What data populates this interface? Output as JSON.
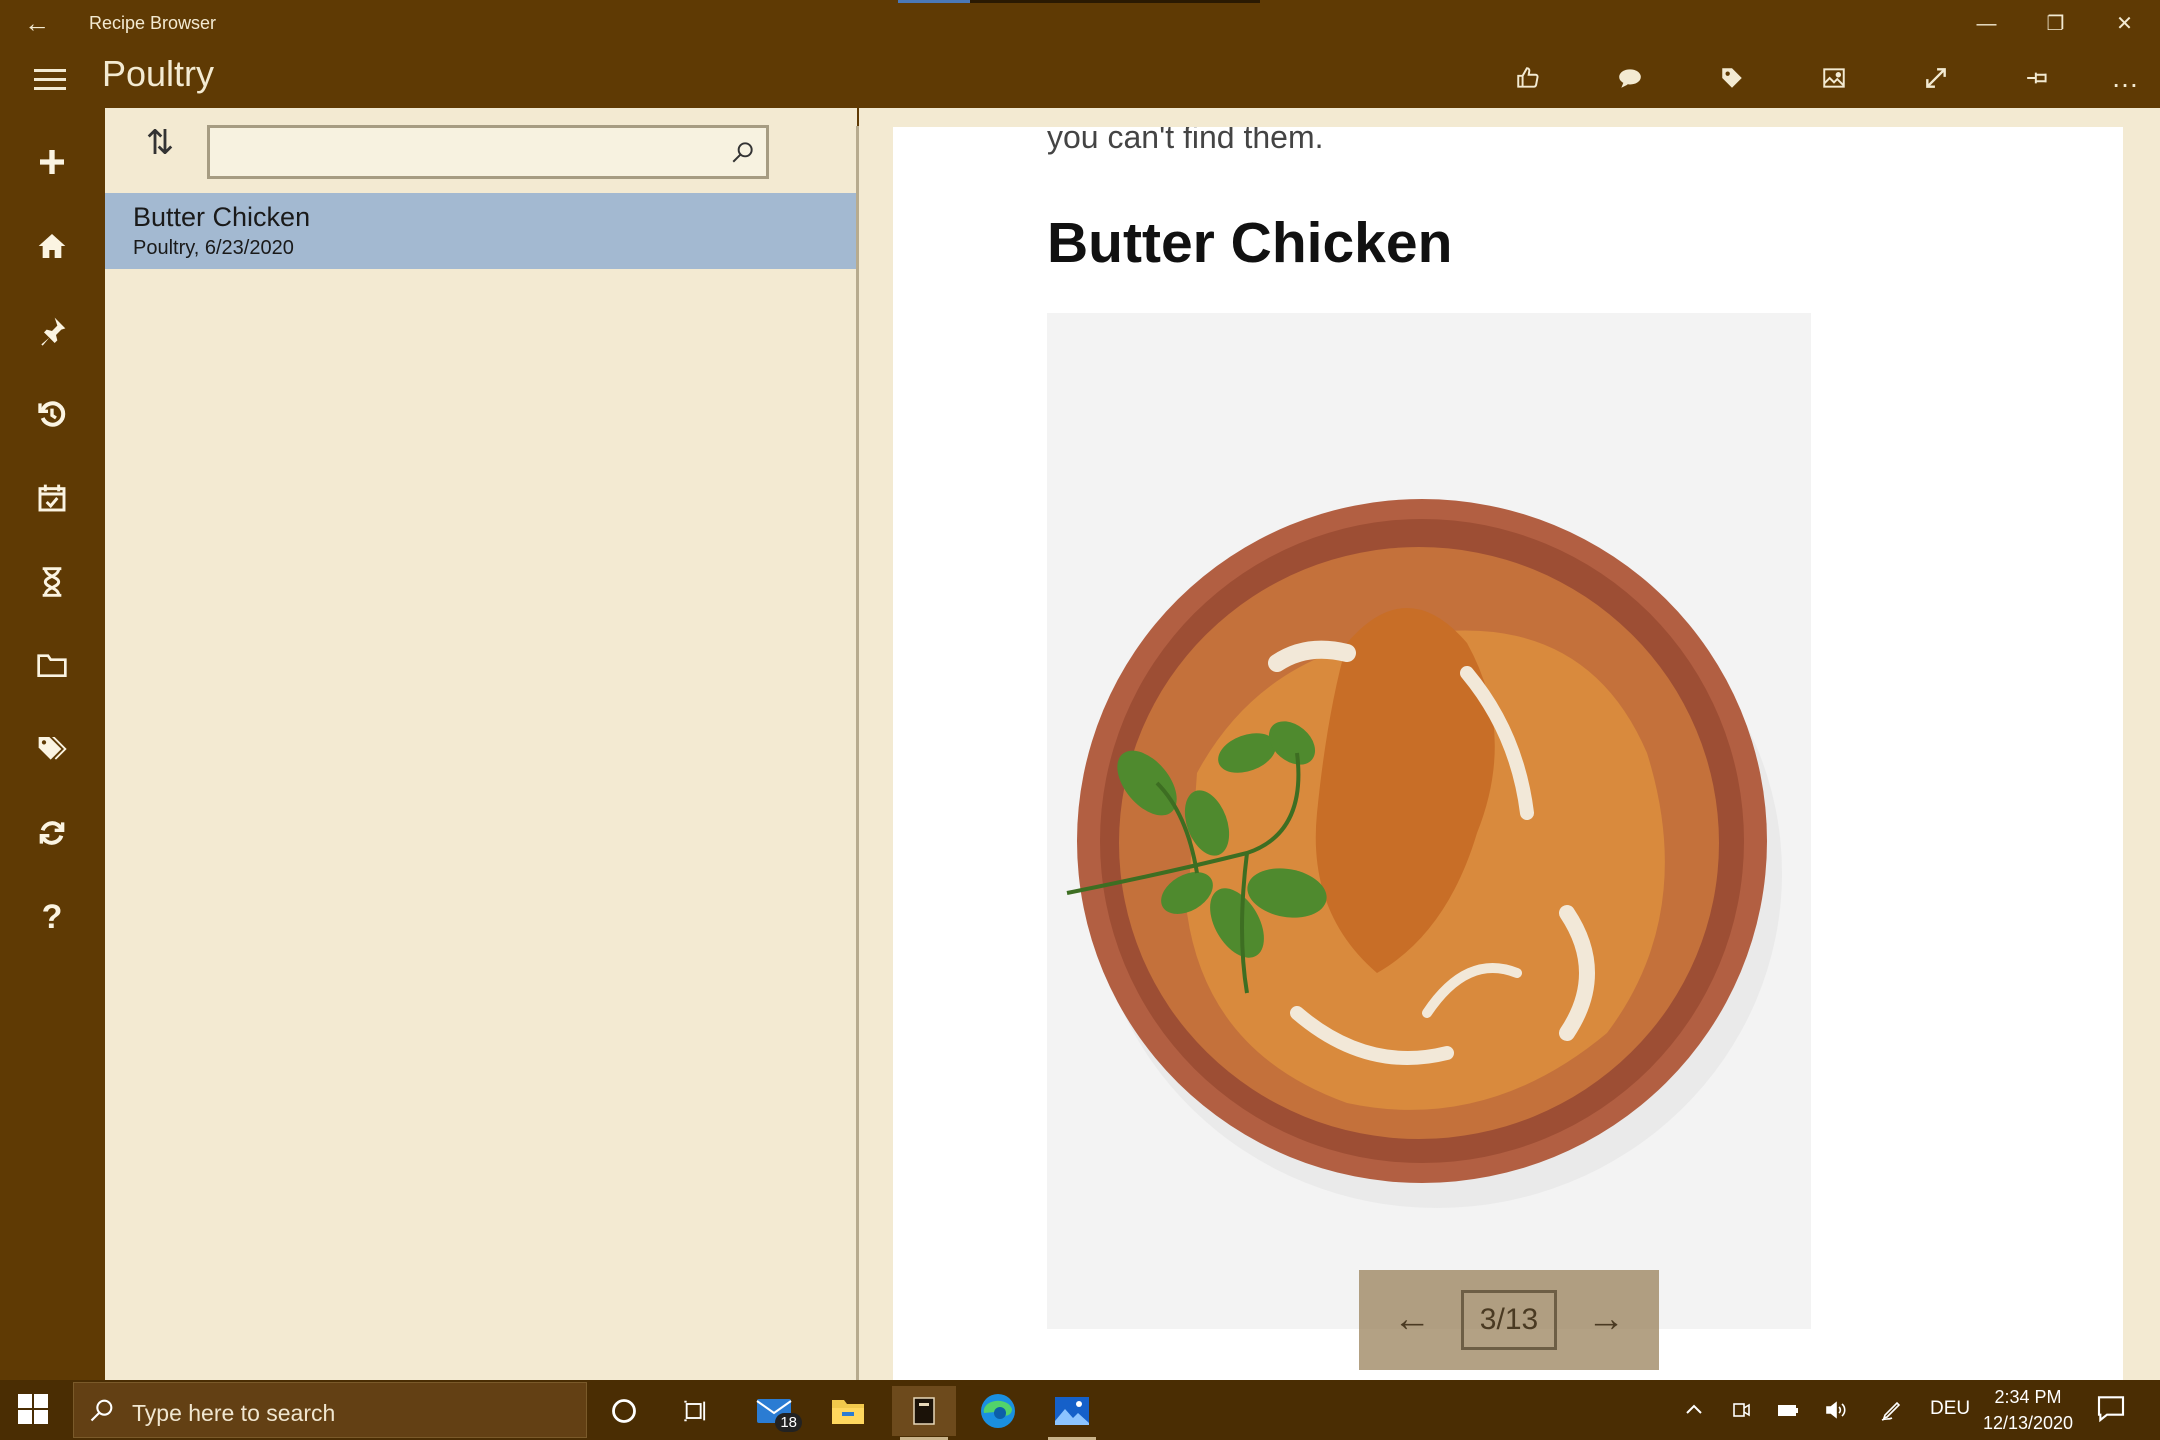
{
  "window": {
    "app_title": "Recipe Browser",
    "back_glyph": "←",
    "minimize_glyph": "—",
    "restore_glyph": "❐",
    "close_glyph": "✕",
    "loading_progress": 0.2
  },
  "header": {
    "page_title": "Poultry",
    "toolbar_icons": [
      "like-icon",
      "comment-icon",
      "tag-icon",
      "image-icon",
      "fullscreen-icon",
      "pin-icon",
      "more-icon"
    ],
    "more_glyph": "…"
  },
  "nav_rail": {
    "items": [
      "add-icon",
      "home-icon",
      "pin-icon",
      "history-icon",
      "calendar-icon",
      "timer-icon",
      "folder-icon",
      "tags-icon",
      "sync-icon",
      "help-icon"
    ]
  },
  "list": {
    "sort_glyph": "⇅",
    "search": {
      "value": "",
      "placeholder": ""
    },
    "items": [
      {
        "title": "Butter Chicken",
        "subtitle": "Poultry, 6/23/2020",
        "selected": true
      }
    ]
  },
  "document": {
    "snippet": "you can't find them.",
    "heading": "Butter Chicken",
    "image_alt": "Butter chicken in a terracotta bowl",
    "pager": {
      "prev_glyph": "←",
      "counter": "3/13",
      "next_glyph": "→"
    }
  },
  "taskbar": {
    "search_placeholder": "Type here to search",
    "mail_badge": "18",
    "language": "DEU",
    "time": "2:34 PM",
    "date": "12/13/2020"
  },
  "colors": {
    "chrome": "#5f3a04",
    "pane_bg": "#f3ead2",
    "selection": "#a3b9d1",
    "taskbar": "#4a2d03"
  }
}
